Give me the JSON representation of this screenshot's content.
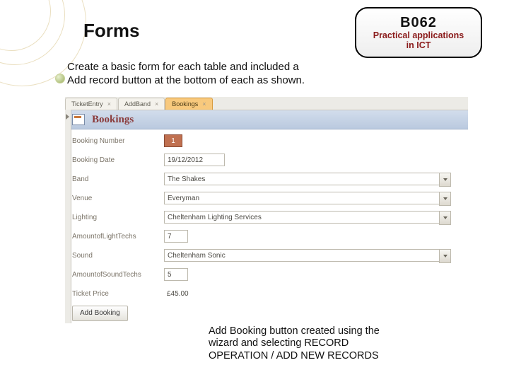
{
  "slide": {
    "title": "Forms",
    "intro_line1": "Create a basic form for each table and included a",
    "intro_line2": "Add record button at the bottom of each as shown.",
    "caption_line1": "Add Booking button created using the",
    "caption_line2": "wizard and selecting RECORD",
    "caption_line3": "OPERATION / ADD NEW RECORDS"
  },
  "badge": {
    "code": "B062",
    "line1": "Practical applications",
    "line2": "in ICT"
  },
  "tabs": {
    "t1": "TicketEntry",
    "t2": "AddBand",
    "t3": "Bookings"
  },
  "form": {
    "title": "Bookings",
    "labels": {
      "booking_number": "Booking Number",
      "booking_date": "Booking Date",
      "band": "Band",
      "venue": "Venue",
      "lighting": "Lighting",
      "amount_light_techs": "AmountofLightTechs",
      "sound": "Sound",
      "amount_sound_techs": "AmountofSoundTechs",
      "ticket_price": "Ticket Price"
    },
    "values": {
      "booking_number": "1",
      "booking_date": "19/12/2012",
      "band": "The Shakes",
      "venue": "Everyman",
      "lighting": "Cheltenham Lighting Services",
      "amount_light_techs": "7",
      "sound": "Cheltenham Sonic",
      "amount_sound_techs": "5",
      "ticket_price": "£45.00"
    },
    "button": "Add Booking"
  }
}
